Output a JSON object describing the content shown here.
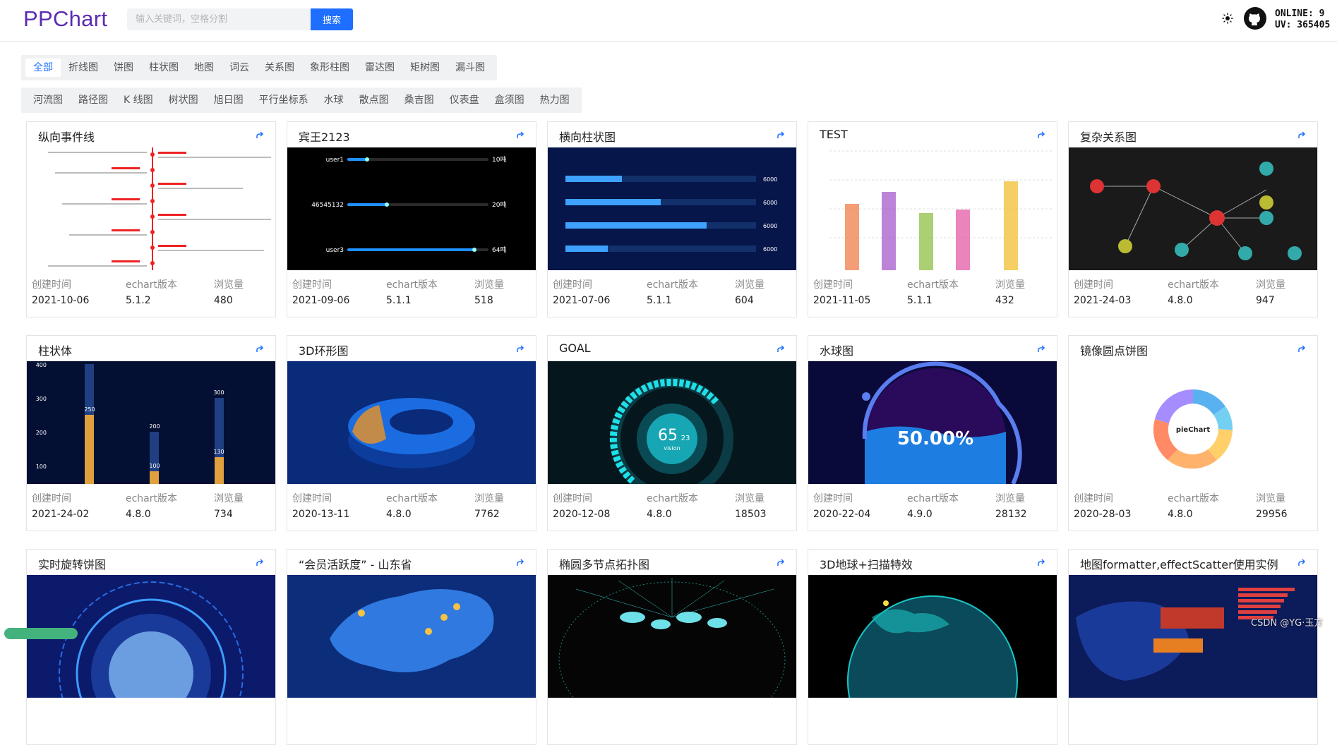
{
  "header": {
    "logo": "PPChart",
    "search_placeholder": "输入关键词，空格分割",
    "search_button": "搜索",
    "online_label": "ONLINE: 9",
    "uv_label": "UV: 365405",
    "icons": [
      "sun-icon",
      "github-icon"
    ]
  },
  "tabs_row1": [
    "全部",
    "折线图",
    "饼图",
    "柱状图",
    "地图",
    "词云",
    "关系图",
    "象形柱图",
    "雷达图",
    "矩树图",
    "漏斗图"
  ],
  "tabs_row2": [
    "河流图",
    "路径图",
    "K 线图",
    "树状图",
    "旭日图",
    "平行坐标系",
    "水球",
    "散点图",
    "桑吉图",
    "仪表盘",
    "盒须图",
    "热力图"
  ],
  "active_tab": "全部",
  "meta_labels": {
    "created": "创建时间",
    "version": "echart版本",
    "views": "浏览量"
  },
  "cards": [
    {
      "title": "纵向事件线",
      "date": "2021-10-06",
      "version": "5.1.2",
      "views": "480"
    },
    {
      "title": "宾王2123",
      "date": "2021-09-06",
      "version": "5.1.1",
      "views": "518"
    },
    {
      "title": "横向柱状图",
      "date": "2021-07-06",
      "version": "5.1.1",
      "views": "604"
    },
    {
      "title": "TEST",
      "date": "2021-11-05",
      "version": "5.1.1",
      "views": "432"
    },
    {
      "title": "复杂关系图",
      "date": "2021-24-03",
      "version": "4.8.0",
      "views": "947"
    },
    {
      "title": "柱状体",
      "date": "2021-24-02",
      "version": "4.8.0",
      "views": "734"
    },
    {
      "title": "3D环形图",
      "date": "2020-13-11",
      "version": "4.8.0",
      "views": "7762"
    },
    {
      "title": "GOAL",
      "date": "2020-12-08",
      "version": "4.8.0",
      "views": "18503"
    },
    {
      "title": "水球图",
      "date": "2020-22-04",
      "version": "4.9.0",
      "views": "28132"
    },
    {
      "title": "镜像圆点饼图",
      "date": "2020-28-03",
      "version": "4.8.0",
      "views": "29956"
    },
    {
      "title": "实时旋转饼图"
    },
    {
      "title": "“会员活跃度” - 山东省"
    },
    {
      "title": "椭圆多节点拓扑图"
    },
    {
      "title": "3D地球+扫描特效"
    },
    {
      "title": "地图formatter,effectScatter使用实例"
    }
  ],
  "thumbs": {
    "bar_progress": {
      "labels": [
        "user1",
        "46545132",
        "user3"
      ],
      "values": [
        "10吨",
        "20吨",
        "64吨"
      ]
    },
    "bar_horizontal": {
      "value_label": "6000"
    },
    "bar_3d": {
      "ticks": [
        "400",
        "300",
        "200",
        "100"
      ],
      "labels": [
        "250",
        "200",
        "300",
        "100",
        "130"
      ]
    },
    "goal": {
      "value": "65",
      "decimal": "23",
      "label": "vision"
    },
    "liquid": {
      "value": "50.00%"
    },
    "pie": {
      "center": "pieChart"
    }
  },
  "watermark": "CSDN @YG·玉方",
  "colors": {
    "brand": "#5b2bb3",
    "accent": "#1e6fff"
  }
}
